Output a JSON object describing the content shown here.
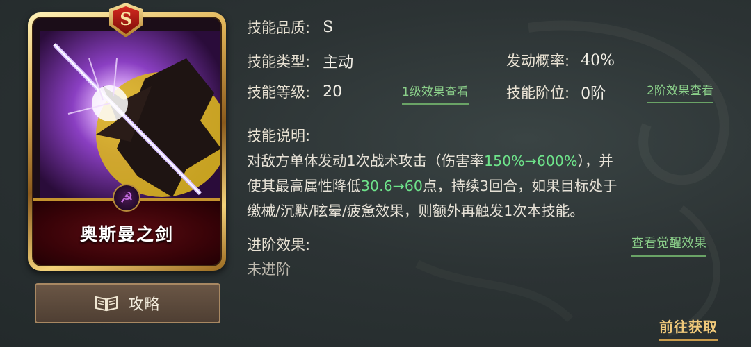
{
  "card": {
    "grade": "S",
    "name": "奥斯曼之剑",
    "faction_icon": "hammer-sickle-icon",
    "art": "sword-and-eagle-illustration"
  },
  "guide_button": {
    "icon": "open-book-icon",
    "label": "攻略"
  },
  "info": {
    "quality_label": "技能品质:",
    "quality_value": "S",
    "type_label": "技能类型:",
    "type_value": "主动",
    "rate_label": "发动概率:",
    "rate_value": "40%",
    "level_label": "技能等级:",
    "level_value": "20",
    "level1_link": "1级效果查看",
    "rank_label": "技能阶位:",
    "rank_value": "0阶",
    "rank2_link": "2阶效果查看"
  },
  "description": {
    "label": "技能说明:",
    "line1_a": "对敌方单体发动1次战术攻击（伤害率",
    "line1_hl": "150%→600%",
    "line1_b": "），并",
    "line2_a": "使其最高属性降低",
    "line2_hl": "30.6→60",
    "line2_b": "点，持续3回合，如果目标处于",
    "line3": "缴械/沉默/眩晕/疲惫效果，则额外再触发1次本技能。"
  },
  "advance": {
    "label": "进阶效果:",
    "value": "未进阶",
    "awaken_link": "查看觉醒效果"
  },
  "get_link": "前往获取",
  "colors": {
    "highlight": "#6ee38a",
    "link": "#8bd08a",
    "gold": "#f0c97a"
  }
}
